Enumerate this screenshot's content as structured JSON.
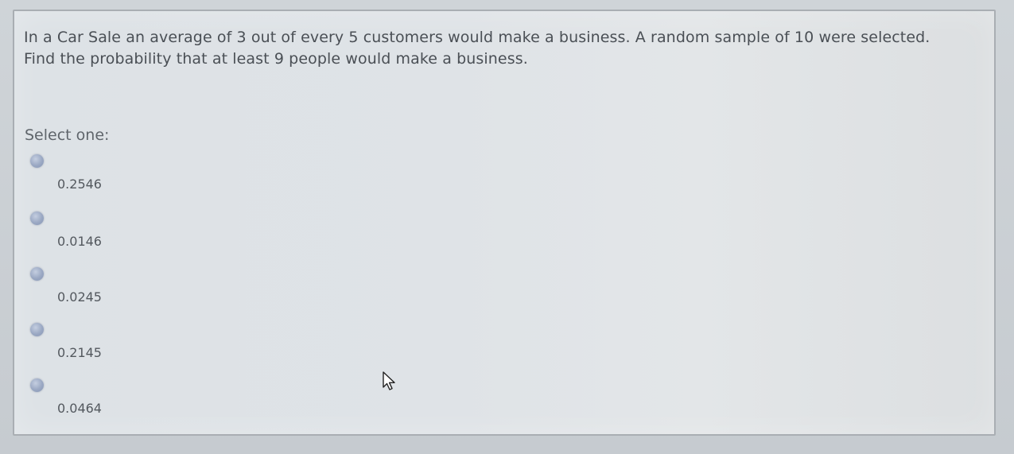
{
  "question": {
    "line1": "In a Car Sale an average of 3 out of every 5 customers would make a business.  A random sample of 10 were selected.",
    "line2": "Find the probability that at least 9 people would make a business."
  },
  "prompt": "Select one:",
  "options": [
    {
      "label": "0.2546"
    },
    {
      "label": "0.0146"
    },
    {
      "label": "0.0245"
    },
    {
      "label": "0.2145"
    },
    {
      "label": "0.0464"
    }
  ],
  "colors": {
    "radio": "#9aa8c3",
    "text": "#4a4f55"
  },
  "icons": {
    "cursor": "pointer-cursor-icon"
  }
}
